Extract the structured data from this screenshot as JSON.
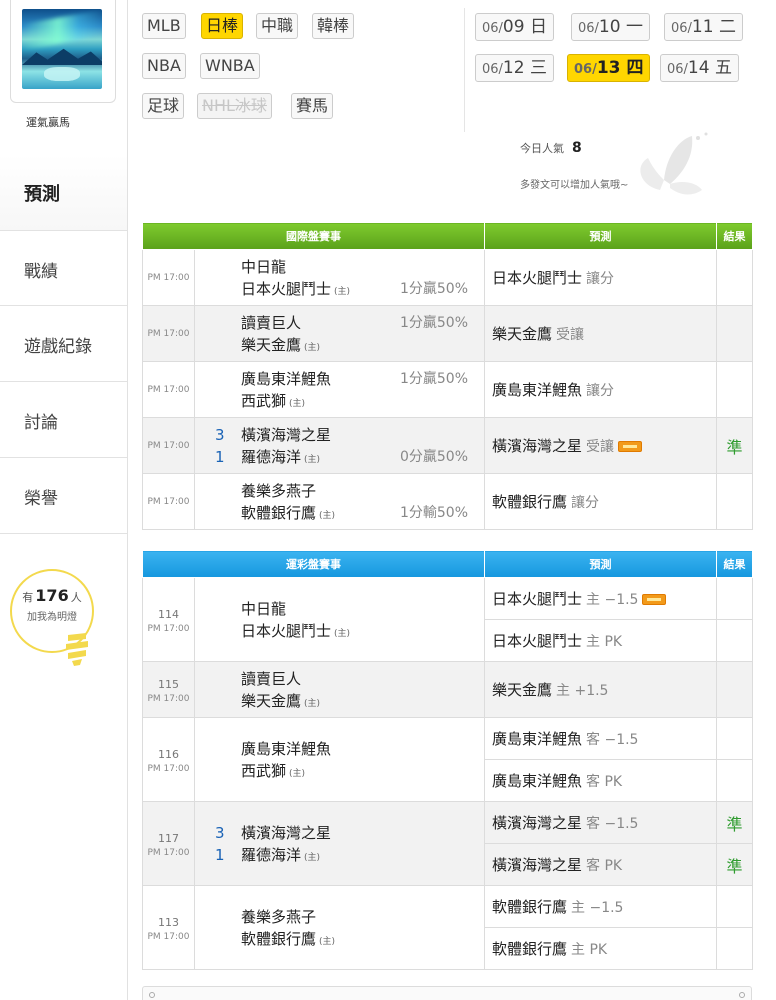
{
  "sidebar": {
    "username": "運氣贏馬",
    "nav": [
      {
        "label": "預測"
      },
      {
        "label": "戰績"
      },
      {
        "label": "遊戲紀錄"
      },
      {
        "label": "討論"
      },
      {
        "label": "榮譽"
      }
    ],
    "fans": {
      "prefix": "有",
      "count": "176",
      "suffix": "人",
      "caption": "加我為明燈"
    }
  },
  "leagues": [
    {
      "label": "MLB"
    },
    {
      "label": "日棒"
    },
    {
      "label": "中職"
    },
    {
      "label": "韓棒"
    },
    {
      "label": "NBA"
    },
    {
      "label": "WNBA"
    },
    {
      "label": "足球"
    },
    {
      "label": "NHL冰球"
    },
    {
      "label": "賽馬"
    }
  ],
  "dates": [
    {
      "md": "06/",
      "d": "09",
      "w": "日"
    },
    {
      "md": "06/",
      "d": "10",
      "w": "一"
    },
    {
      "md": "06/",
      "d": "11",
      "w": "二"
    },
    {
      "md": "06/",
      "d": "12",
      "w": "三"
    },
    {
      "md": "06/",
      "d": "13",
      "w": "四"
    },
    {
      "md": "06/",
      "d": "14",
      "w": "五"
    }
  ],
  "popularity": {
    "label": "今日人氣",
    "value": "8",
    "note": "多發文可以增加人氣哦~"
  },
  "intl": {
    "headers": {
      "match": "國際盤賽事",
      "pred": "預測",
      "result": "結果"
    },
    "rows": [
      {
        "time": "PM 17:00",
        "away": "中日龍",
        "home": "日本火腿鬥士",
        "home_tag": "(主)",
        "s1": "",
        "s2": "",
        "odds": "1分贏50%",
        "odds_row": 2,
        "pick": "日本火腿鬥士",
        "mode": "讓分",
        "result": ""
      },
      {
        "time": "PM 17:00",
        "away": "讀賣巨人",
        "home": "樂天金鷹",
        "home_tag": "(主)",
        "s1": "",
        "s2": "",
        "odds": "1分贏50%",
        "odds_row": 1,
        "pick": "樂天金鷹",
        "mode": "受讓",
        "result": ""
      },
      {
        "time": "PM 17:00",
        "away": "廣島東洋鯉魚",
        "home": "西武獅",
        "home_tag": "(主)",
        "s1": "",
        "s2": "",
        "odds": "1分贏50%",
        "odds_row": 1,
        "pick": "廣島東洋鯉魚",
        "mode": "讓分",
        "result": ""
      },
      {
        "time": "PM 17:00",
        "away": "橫濱海灣之星",
        "home": "羅德海洋",
        "home_tag": "(主)",
        "s1": "3",
        "s2": "1",
        "odds": "0分贏50%",
        "odds_row": 2,
        "pick": "橫濱海灣之星",
        "mode": "受讓",
        "result": "準"
      },
      {
        "time": "PM 17:00",
        "away": "養樂多燕子",
        "home": "軟體銀行鷹",
        "home_tag": "(主)",
        "s1": "",
        "s2": "",
        "odds": "1分輸50%",
        "odds_row": 2,
        "pick": "軟體銀行鷹",
        "mode": "讓分",
        "result": ""
      }
    ]
  },
  "lottery": {
    "headers": {
      "match": "運彩盤賽事",
      "pred": "預測",
      "result": "結果"
    },
    "games": [
      {
        "no": "114",
        "time": "PM 17:00",
        "away": "中日龍",
        "home": "日本火腿鬥士",
        "home_tag": "(主)",
        "s1": "",
        "s2": "",
        "picks": [
          {
            "team": "日本火腿鬥士",
            "line": "主 −1.5",
            "badge": true,
            "result": ""
          },
          {
            "team": "日本火腿鬥士",
            "line": "主 PK",
            "badge": false,
            "result": ""
          }
        ]
      },
      {
        "no": "115",
        "time": "PM 17:00",
        "away": "讀賣巨人",
        "home": "樂天金鷹",
        "home_tag": "(主)",
        "s1": "",
        "s2": "",
        "picks": [
          {
            "team": "樂天金鷹",
            "line": "主 +1.5",
            "badge": false,
            "result": ""
          }
        ]
      },
      {
        "no": "116",
        "time": "PM 17:00",
        "away": "廣島東洋鯉魚",
        "home": "西武獅",
        "home_tag": "(主)",
        "s1": "",
        "s2": "",
        "picks": [
          {
            "team": "廣島東洋鯉魚",
            "line": "客 −1.5",
            "badge": false,
            "result": ""
          },
          {
            "team": "廣島東洋鯉魚",
            "line": "客 PK",
            "badge": false,
            "result": ""
          }
        ]
      },
      {
        "no": "117",
        "time": "PM 17:00",
        "away": "橫濱海灣之星",
        "home": "羅德海洋",
        "home_tag": "(主)",
        "s1": "3",
        "s2": "1",
        "picks": [
          {
            "team": "橫濱海灣之星",
            "line": "客 −1.5",
            "badge": false,
            "result": "準"
          },
          {
            "team": "橫濱海灣之星",
            "line": "客 PK",
            "badge": false,
            "result": "準"
          }
        ]
      },
      {
        "no": "113",
        "time": "PM 17:00",
        "away": "養樂多燕子",
        "home": "軟體銀行鷹",
        "home_tag": "(主)",
        "s1": "",
        "s2": "",
        "picks": [
          {
            "team": "軟體銀行鷹",
            "line": "主 −1.5",
            "badge": false,
            "result": ""
          },
          {
            "team": "軟體銀行鷹",
            "line": "主 PK",
            "badge": false,
            "result": ""
          }
        ]
      }
    ]
  },
  "colors": {
    "selected": "#ffd600",
    "intl_header": "#5aa11a",
    "lottery_header": "#1597de",
    "hit": "#2f9c2f",
    "score": "#1a63b6"
  }
}
